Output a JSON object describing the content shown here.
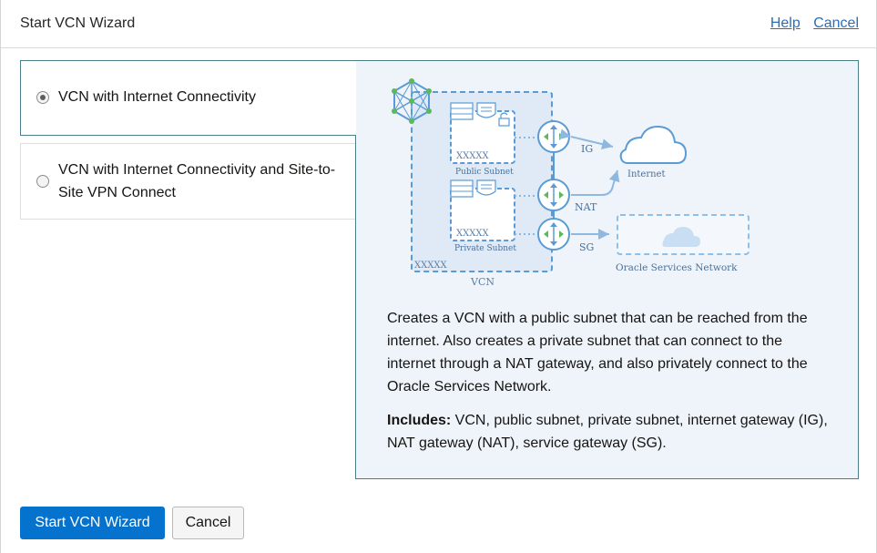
{
  "header": {
    "title": "Start VCN Wizard",
    "help_link": "Help",
    "cancel_link": "Cancel"
  },
  "options": [
    {
      "label": "VCN with Internet Connectivity",
      "selected": true
    },
    {
      "label": "VCN with Internet Connectivity and Site-to-Site VPN Connect",
      "selected": false
    }
  ],
  "diagram": {
    "public_subnet_cidr": "XXXXX",
    "public_subnet_label": "Public Subnet",
    "private_subnet_cidr": "XXXXX",
    "private_subnet_label": "Private Subnet",
    "vcn_cidr": "XXXXX",
    "vcn_label": "VCN",
    "ig_label": "IG",
    "nat_label": "NAT",
    "sg_label": "SG",
    "internet_label": "Internet",
    "osn_label": "Oracle Services Network"
  },
  "description": "Creates a VCN with a public subnet that can be reached from the internet. Also creates a private subnet that can connect to the internet through a NAT gateway, and also privately connect to the Oracle Services Network.",
  "includes": {
    "label": "Includes:",
    "text": " VCN, public subnet, private subnet, internet gateway (IG), NAT gateway (NAT), service gateway (SG)."
  },
  "footer": {
    "start_button": "Start VCN Wizard",
    "cancel_button": "Cancel"
  },
  "colors": {
    "accent": "#0572ce",
    "link": "#2a6ebb",
    "panel_bg": "#eef4fa",
    "panel_border": "#4a7f8a",
    "diagram_blue": "#5b9bd5",
    "diagram_green": "#5cb85c"
  }
}
